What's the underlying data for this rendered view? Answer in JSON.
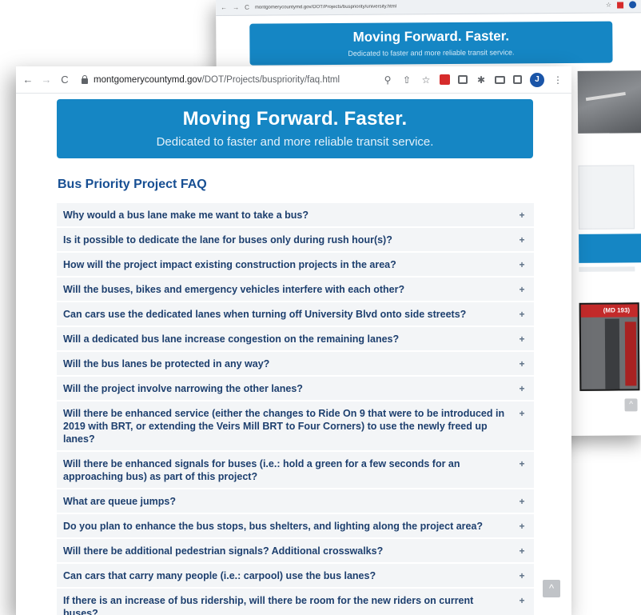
{
  "back_window": {
    "url": "montgomerycountymd.gov/DOT/Projects/buspriority/university.html",
    "banner_title": "Moving Forward. Faster.",
    "banner_subtitle": "Dedicated to faster and more reliable transit service.",
    "map_label": "(MD 193)",
    "scroll_top_glyph": "^"
  },
  "browser": {
    "back_glyph": "←",
    "forward_glyph": "→",
    "reload_glyph": "C",
    "url_domain": "montgomerycountymd.gov",
    "url_path": "/DOT/Projects/buspriority/faq.html",
    "zoom_glyph": "⚲",
    "share_glyph": "⇧",
    "star_glyph": "☆",
    "puzzle_glyph": "✱",
    "menu_glyph": "⋮",
    "avatar_letter": "J",
    "icons": [
      "search-icon",
      "share-icon",
      "bookmark-star-icon",
      "pdf-extension-icon",
      "camera-extension-icon",
      "puzzle-icon",
      "reading-list-icon",
      "sidebar-icon",
      "profile-avatar",
      "menu-icon"
    ]
  },
  "banner": {
    "title": "Moving Forward. Faster.",
    "subtitle": "Dedicated to faster and more reliable transit service."
  },
  "faq": {
    "heading": "Bus Priority Project FAQ",
    "toggle_glyph": "+",
    "items": [
      {
        "question": "Why would a bus lane make me want to take a bus?"
      },
      {
        "question": "Is it possible to dedicate the lane for buses only during rush hour(s)?"
      },
      {
        "question": "How will the project impact existing construction projects in the area?"
      },
      {
        "question": "Will the buses, bikes and emergency vehicles interfere with each other?"
      },
      {
        "question": "Can cars use the dedicated lanes when turning off University Blvd onto side streets?"
      },
      {
        "question": "Will a dedicated bus lane increase congestion on the remaining lanes?"
      },
      {
        "question": "Will the bus lanes be protected in any way?"
      },
      {
        "question": "Will the project involve narrowing the other lanes?"
      },
      {
        "question": "Will there be enhanced service (either the changes to Ride On 9 that were to be introduced in 2019 with BRT, or extending the Veirs Mill BRT to Four Corners) to use the newly freed up lanes?"
      },
      {
        "question": "Will there be enhanced signals for buses (i.e.: hold a green for a few seconds for an approaching bus) as part of this project?"
      },
      {
        "question": "What are queue jumps?"
      },
      {
        "question": "Do you plan to enhance the bus stops, bus shelters, and lighting along the project area?"
      },
      {
        "question": "Will there be additional pedestrian signals? Additional crosswalks?"
      },
      {
        "question": "Can cars that carry many people (i.e.: carpool) use the bus lanes?"
      },
      {
        "question": "If there is an increase of bus ridership, will there be room for the new riders on current buses?"
      }
    ]
  },
  "scroll_top_glyph": "^",
  "colors": {
    "banner_blue": "#1586c4",
    "heading_blue": "#174f93",
    "question_text": "#1d3f6e",
    "item_background": "#f3f5f7"
  }
}
